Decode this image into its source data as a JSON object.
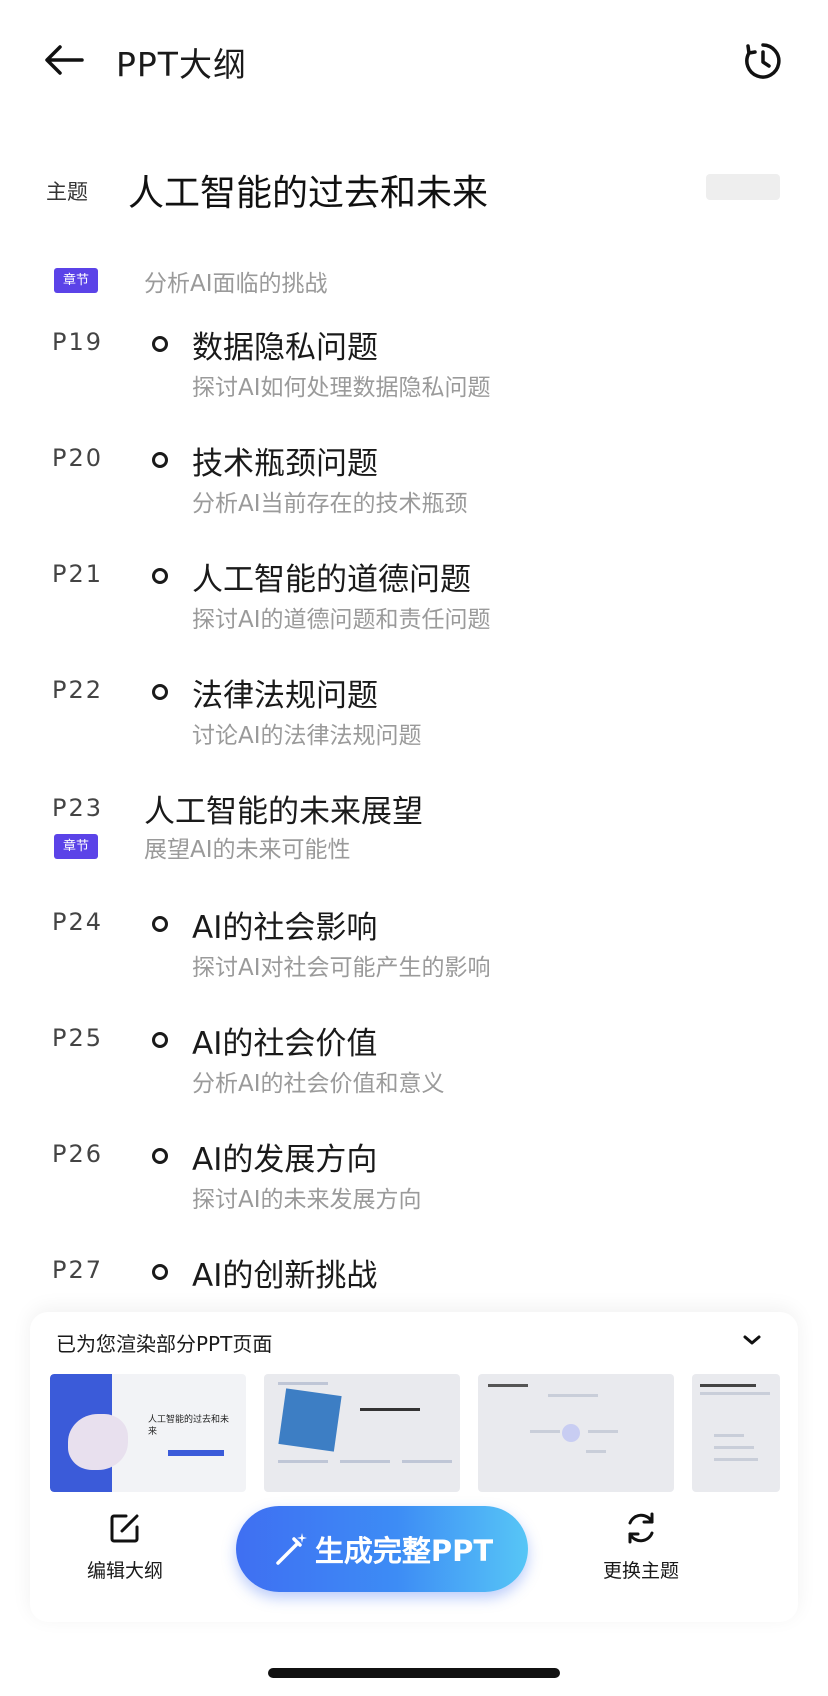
{
  "header": {
    "title": "PPT大纲",
    "back_icon": "arrow-left-icon",
    "history_icon": "clock-history-icon"
  },
  "topic": {
    "label": "主题",
    "value": "人工智能的过去和未来"
  },
  "outline": {
    "section_tag": "章节",
    "sections": [
      {
        "page": "",
        "title": "",
        "subtitle": "分析AI面临的挑战",
        "items": [
          {
            "page": "P19",
            "title": "数据隐私问题",
            "subtitle": "探讨AI如何处理数据隐私问题"
          },
          {
            "page": "P20",
            "title": "技术瓶颈问题",
            "subtitle": "分析AI当前存在的技术瓶颈"
          },
          {
            "page": "P21",
            "title": "人工智能的道德问题",
            "subtitle": "探讨AI的道德问题和责任问题"
          },
          {
            "page": "P22",
            "title": "法律法规问题",
            "subtitle": "讨论AI的法律法规问题"
          }
        ]
      },
      {
        "page": "P23",
        "title": "人工智能的未来展望",
        "subtitle": "展望AI的未来可能性",
        "items": [
          {
            "page": "P24",
            "title": "AI的社会影响",
            "subtitle": "探讨AI对社会可能产生的影响"
          },
          {
            "page": "P25",
            "title": "AI的社会价值",
            "subtitle": "分析AI的社会价值和意义"
          },
          {
            "page": "P26",
            "title": "AI的发展方向",
            "subtitle": "探讨AI的未来发展方向"
          },
          {
            "page": "P27",
            "title": "AI的创新挑战",
            "subtitle": ""
          }
        ]
      }
    ]
  },
  "render_panel": {
    "label": "已为您渲染部分PPT页面",
    "collapse_icon": "chevron-down-icon",
    "thumb1_title": "人工智能的过去和未来"
  },
  "actions": {
    "edit_label": "编辑大纲",
    "edit_icon": "edit-icon",
    "generate_label": "生成完整PPT",
    "generate_icon": "magic-wand-icon",
    "theme_label": "更换主题",
    "theme_icon": "refresh-icon"
  },
  "colors": {
    "accent": "#5b43e8",
    "button_start": "#3f6ff2",
    "button_end": "#57c6f6"
  }
}
